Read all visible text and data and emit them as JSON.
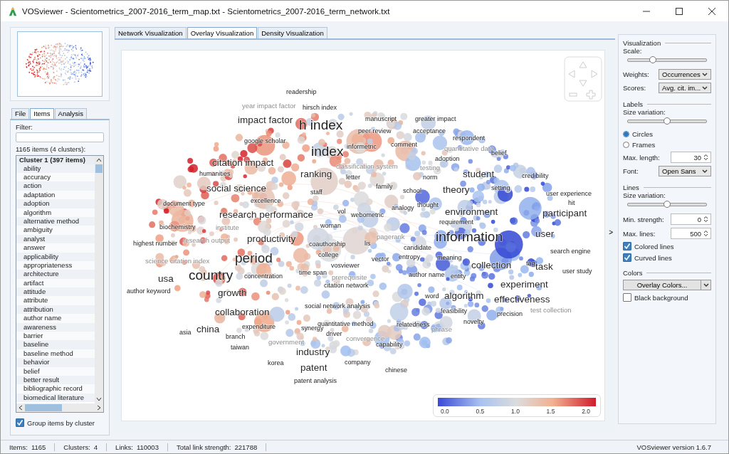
{
  "window": {
    "title": "VOSviewer - Scientometrics_2007-2016_term_map.txt - Scientometrics_2007-2016_term_network.txt"
  },
  "left_tabs": [
    {
      "label": "File",
      "selected": false
    },
    {
      "label": "Items",
      "selected": true
    },
    {
      "label": "Analysis",
      "selected": false
    }
  ],
  "filter": {
    "label": "Filter:"
  },
  "items_summary": "1165 items (4 clusters):",
  "cluster_header": "Cluster 1 (397 items)",
  "items": [
    "ability",
    "accuracy",
    "action",
    "adaptation",
    "adoption",
    "algorithm",
    "alternative method",
    "ambiguity",
    "analyst",
    "answer",
    "applicability",
    "appropriateness",
    "architecture",
    "artifact",
    "attitude",
    "attribute",
    "attribution",
    "author name",
    "awareness",
    "barrier",
    "baseline",
    "baseline method",
    "behavior",
    "belief",
    "better result",
    "bibliographic record",
    "biomedical literature"
  ],
  "group_by_cluster": {
    "label": "Group items by cluster",
    "checked": true
  },
  "view_tabs": [
    {
      "label": "Network Visualization",
      "selected": false
    },
    {
      "label": "Overlay Visualization",
      "selected": true
    },
    {
      "label": "Density Visualization",
      "selected": false
    }
  ],
  "terms": [
    {
      "text": "readership",
      "kind": "small"
    },
    {
      "text": "year impact factor",
      "kind": "faint"
    },
    {
      "text": "hirsch index",
      "kind": "small"
    },
    {
      "text": "impact factor",
      "kind": "medium"
    },
    {
      "text": "h index",
      "kind": "large"
    },
    {
      "text": "manuscript",
      "kind": "small"
    },
    {
      "text": "greater impact",
      "kind": "small"
    },
    {
      "text": "peer review",
      "kind": "small"
    },
    {
      "text": "acceptance",
      "kind": "small"
    },
    {
      "text": "google scholar",
      "kind": "small"
    },
    {
      "text": "respondent",
      "kind": "small"
    },
    {
      "text": "index",
      "kind": "large"
    },
    {
      "text": "informetric",
      "kind": "small"
    },
    {
      "text": "comment",
      "kind": "small"
    },
    {
      "text": "quantitative data",
      "kind": "faint"
    },
    {
      "text": "citation impact",
      "kind": "medium"
    },
    {
      "text": "adoption",
      "kind": "small"
    },
    {
      "text": "belief",
      "kind": "small"
    },
    {
      "text": "classification system",
      "kind": "faint"
    },
    {
      "text": "testing",
      "kind": "faint"
    },
    {
      "text": "humanities",
      "kind": "small"
    },
    {
      "text": "ranking",
      "kind": "medium"
    },
    {
      "text": "letter",
      "kind": "small"
    },
    {
      "text": "norm",
      "kind": "small"
    },
    {
      "text": "student",
      "kind": "medium"
    },
    {
      "text": "credibility",
      "kind": "small"
    },
    {
      "text": "social science",
      "kind": "medium"
    },
    {
      "text": "staff",
      "kind": "small"
    },
    {
      "text": "family",
      "kind": "small"
    },
    {
      "text": "school",
      "kind": "small"
    },
    {
      "text": "theory",
      "kind": "medium"
    },
    {
      "text": "setting",
      "kind": "small"
    },
    {
      "text": "user experience",
      "kind": "small"
    },
    {
      "text": "document type",
      "kind": "small"
    },
    {
      "text": "excellence",
      "kind": "small"
    },
    {
      "text": "research performance",
      "kind": "medium"
    },
    {
      "text": "vol",
      "kind": "small"
    },
    {
      "text": "webometric",
      "kind": "small"
    },
    {
      "text": "analogy",
      "kind": "small"
    },
    {
      "text": "thought",
      "kind": "small"
    },
    {
      "text": "environment",
      "kind": "medium"
    },
    {
      "text": "participant",
      "kind": "medium"
    },
    {
      "text": "hit",
      "kind": "small"
    },
    {
      "text": "biochemistry",
      "kind": "small"
    },
    {
      "text": "institute",
      "kind": "faint"
    },
    {
      "text": "woman",
      "kind": "small"
    },
    {
      "text": "requirement",
      "kind": "small"
    },
    {
      "text": "highest number",
      "kind": "small"
    },
    {
      "text": "research output",
      "kind": "faint"
    },
    {
      "text": "productivity",
      "kind": "medium"
    },
    {
      "text": "coauthorship",
      "kind": "small"
    },
    {
      "text": "lis",
      "kind": "small"
    },
    {
      "text": "pagerank",
      "kind": "faint"
    },
    {
      "text": "candidate",
      "kind": "small"
    },
    {
      "text": "information",
      "kind": "large"
    },
    {
      "text": "user",
      "kind": "medium"
    },
    {
      "text": "science citation index",
      "kind": "faint"
    },
    {
      "text": "period",
      "kind": "large"
    },
    {
      "text": "college",
      "kind": "small"
    },
    {
      "text": "vector",
      "kind": "small"
    },
    {
      "text": "entropy",
      "kind": "small"
    },
    {
      "text": "meaning",
      "kind": "small"
    },
    {
      "text": "search engine",
      "kind": "small"
    },
    {
      "text": "vosviewer",
      "kind": "small"
    },
    {
      "text": "collection",
      "kind": "medium"
    },
    {
      "text": "tag",
      "kind": "small"
    },
    {
      "text": "task",
      "kind": "medium"
    },
    {
      "text": "usa",
      "kind": "medium"
    },
    {
      "text": "country",
      "kind": "large"
    },
    {
      "text": "concentration",
      "kind": "small"
    },
    {
      "text": "time span",
      "kind": "small"
    },
    {
      "text": "prerequisite",
      "kind": "faint"
    },
    {
      "text": "author name",
      "kind": "small"
    },
    {
      "text": "entity",
      "kind": "small"
    },
    {
      "text": "user study",
      "kind": "small"
    },
    {
      "text": "citation network",
      "kind": "small"
    },
    {
      "text": "experiment",
      "kind": "medium"
    },
    {
      "text": "author keyword",
      "kind": "small"
    },
    {
      "text": "growth",
      "kind": "medium"
    },
    {
      "text": "word",
      "kind": "small"
    },
    {
      "text": "algorithm",
      "kind": "medium"
    },
    {
      "text": "effectiveness",
      "kind": "medium"
    },
    {
      "text": "collaboration",
      "kind": "medium"
    },
    {
      "text": "social network analysis",
      "kind": "small"
    },
    {
      "text": "feasibility",
      "kind": "small"
    },
    {
      "text": "precision",
      "kind": "small"
    },
    {
      "text": "test collection",
      "kind": "faint"
    },
    {
      "text": "china",
      "kind": "medium"
    },
    {
      "text": "expenditure",
      "kind": "small"
    },
    {
      "text": "synergy",
      "kind": "small"
    },
    {
      "text": "quantitative method",
      "kind": "small"
    },
    {
      "text": "relatedness",
      "kind": "small"
    },
    {
      "text": "phrase",
      "kind": "faint"
    },
    {
      "text": "novelty",
      "kind": "small"
    },
    {
      "text": "asia",
      "kind": "small"
    },
    {
      "text": "branch",
      "kind": "small"
    },
    {
      "text": "driver",
      "kind": "small"
    },
    {
      "text": "convergence",
      "kind": "faint"
    },
    {
      "text": "taiwan",
      "kind": "small"
    },
    {
      "text": "government",
      "kind": "faint"
    },
    {
      "text": "capability",
      "kind": "small"
    },
    {
      "text": "industry",
      "kind": "medium"
    },
    {
      "text": "korea",
      "kind": "small"
    },
    {
      "text": "company",
      "kind": "small"
    },
    {
      "text": "patent",
      "kind": "medium"
    },
    {
      "text": "chinese",
      "kind": "small"
    },
    {
      "text": "patent analysis",
      "kind": "small"
    }
  ],
  "legend": {
    "ticks": [
      "0.0",
      "0.5",
      "1.0",
      "1.5",
      "2.0"
    ]
  },
  "collapse_arrow": ">",
  "panel": {
    "visualization": {
      "title": "Visualization",
      "scale": {
        "label": "Scale:",
        "level": 0.32
      },
      "weights": {
        "label": "Weights:",
        "value": "Occurrences"
      },
      "scores": {
        "label": "Scores:",
        "value": "Avg. cit. im..."
      }
    },
    "labels": {
      "title": "Labels",
      "size_variation": {
        "label": "Size variation:",
        "level": 0.5
      },
      "shapes": [
        {
          "label": "Circles",
          "selected": true
        },
        {
          "label": "Frames",
          "selected": false
        }
      ],
      "max_length": {
        "label": "Max. length:",
        "value": "30"
      },
      "font": {
        "label": "Font:",
        "value": "Open Sans"
      }
    },
    "lines": {
      "title": "Lines",
      "size_variation": {
        "label": "Size variation:",
        "level": 0.5
      },
      "min_strength": {
        "label": "Min. strength:",
        "value": "0"
      },
      "max_lines": {
        "label": "Max. lines:",
        "value": "500"
      },
      "options": [
        {
          "label": "Colored lines",
          "checked": true
        },
        {
          "label": "Curved lines",
          "checked": true
        }
      ]
    },
    "colors": {
      "title": "Colors",
      "button": "Overlay Colors...",
      "black_background": {
        "label": "Black background",
        "checked": false
      }
    }
  },
  "status_bar": [
    {
      "label": "Items:",
      "value": "1165"
    },
    {
      "label": "Clusters:",
      "value": "4"
    },
    {
      "label": "Links:",
      "value": "110003"
    },
    {
      "label": "Total link strength:",
      "value": "221788"
    }
  ],
  "version": "VOSviewer version 1.6.7"
}
